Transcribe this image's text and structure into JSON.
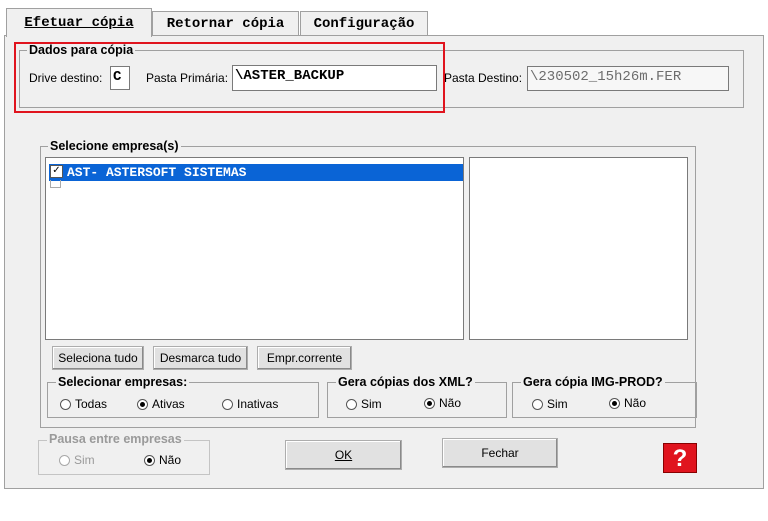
{
  "tabs": [
    {
      "label": "Efetuar cópia",
      "accesskey": "E"
    },
    {
      "label": "Retornar cópia",
      "accesskey": "R"
    },
    {
      "label": "Configuração",
      "accesskey": "C"
    }
  ],
  "dados": {
    "legend": "Dados para cópia",
    "drive_label": "Drive destino:",
    "drive_value": "C",
    "pasta_primaria_label": "Pasta Primária:",
    "pasta_primaria_value": "\\ASTER_BACKUP",
    "pasta_destino_label": "Pasta Destino:",
    "pasta_destino_value": "\\230502_15h26m.FER"
  },
  "empresas": {
    "legend": "Selecione empresa(s)",
    "items": [
      {
        "label": "AST- ASTERSOFT SISTEMAS",
        "checked": true
      }
    ],
    "buttons": {
      "seleciona": "Seleciona tudo",
      "desmarca": "Desmarca tudo",
      "corrente": "Empr.corrente"
    }
  },
  "selecionar": {
    "legend": "Selecionar empresas:",
    "options": [
      "Todas",
      "Ativas",
      "Inativas"
    ],
    "selected": "Ativas"
  },
  "xml": {
    "legend": "Gera cópias dos XML?",
    "options": [
      "Sim",
      "Não"
    ],
    "selected": "Não"
  },
  "img": {
    "legend": "Gera cópia IMG-PROD?",
    "options": [
      "Sim",
      "Não"
    ],
    "selected": "Não"
  },
  "pausa": {
    "legend": "Pausa entre empresas",
    "options": [
      "Sim",
      "Não"
    ],
    "selected": "Não"
  },
  "footer": {
    "ok": "OK",
    "fechar": "Fechar",
    "help_glyph": "?"
  },
  "colors": {
    "selection": "#0a64d6",
    "highlight_border": "#e0141e",
    "help_bg": "#e0141e"
  }
}
